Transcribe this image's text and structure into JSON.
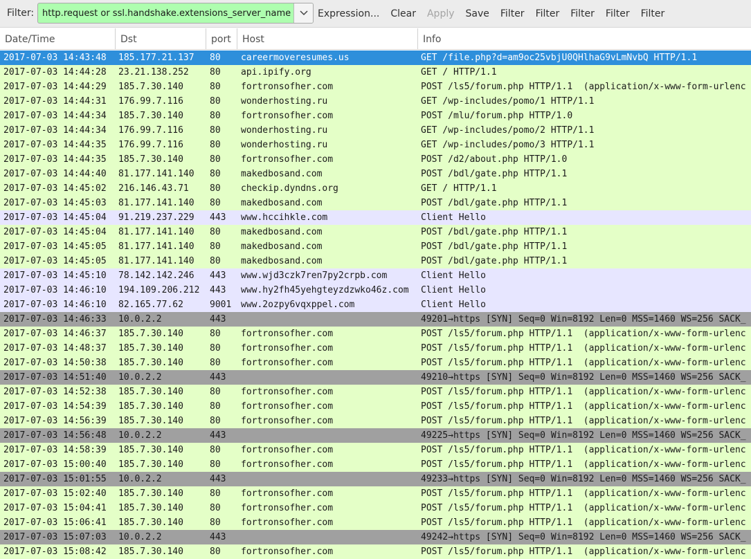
{
  "toolbar": {
    "filter_label": "Filter:",
    "filter_value": "http.request or ssl.handshake.extensions_server_name",
    "buttons": [
      {
        "label": "Expression...",
        "disabled": false
      },
      {
        "label": "Clear",
        "disabled": false
      },
      {
        "label": "Apply",
        "disabled": true
      },
      {
        "label": "Save",
        "disabled": false
      },
      {
        "label": "Filter",
        "disabled": false
      },
      {
        "label": "Filter",
        "disabled": false
      },
      {
        "label": "Filter",
        "disabled": false
      },
      {
        "label": "Filter",
        "disabled": false
      },
      {
        "label": "Filter",
        "disabled": false
      }
    ]
  },
  "columns": [
    "Date/Time",
    "Dst",
    "port",
    "Host",
    "Info"
  ],
  "colors": {
    "selected": "#2e8fdb",
    "http": "#e4ffc7",
    "tls": "#e7e6ff",
    "tcp_syn": "#a0a0a0"
  },
  "rows": [
    {
      "type": "selected",
      "time": "2017-07-03 14:43:48",
      "dst": "185.177.21.137",
      "port": "80",
      "host": "careermoveresumes.us",
      "info": "GET /file.php?d=am9oc25vbjU0QHlhaG9vLmNvbQ HTTP/1.1"
    },
    {
      "type": "http",
      "time": "2017-07-03 14:44:28",
      "dst": "23.21.138.252",
      "port": "80",
      "host": "api.ipify.org",
      "info": "GET / HTTP/1.1"
    },
    {
      "type": "http",
      "time": "2017-07-03 14:44:29",
      "dst": "185.7.30.140",
      "port": "80",
      "host": "fortronsofher.com",
      "info": "POST /ls5/forum.php HTTP/1.1  (application/x-www-form-urlenc"
    },
    {
      "type": "http",
      "time": "2017-07-03 14:44:31",
      "dst": "176.99.7.116",
      "port": "80",
      "host": "wonderhosting.ru",
      "info": "GET /wp-includes/pomo/1 HTTP/1.1"
    },
    {
      "type": "http",
      "time": "2017-07-03 14:44:34",
      "dst": "185.7.30.140",
      "port": "80",
      "host": "fortronsofher.com",
      "info": "POST /mlu/forum.php HTTP/1.0"
    },
    {
      "type": "http",
      "time": "2017-07-03 14:44:34",
      "dst": "176.99.7.116",
      "port": "80",
      "host": "wonderhosting.ru",
      "info": "GET /wp-includes/pomo/2 HTTP/1.1"
    },
    {
      "type": "http",
      "time": "2017-07-03 14:44:35",
      "dst": "176.99.7.116",
      "port": "80",
      "host": "wonderhosting.ru",
      "info": "GET /wp-includes/pomo/3 HTTP/1.1"
    },
    {
      "type": "http",
      "time": "2017-07-03 14:44:35",
      "dst": "185.7.30.140",
      "port": "80",
      "host": "fortronsofher.com",
      "info": "POST /d2/about.php HTTP/1.0"
    },
    {
      "type": "http",
      "time": "2017-07-03 14:44:40",
      "dst": "81.177.141.140",
      "port": "80",
      "host": "makedbosand.com",
      "info": "POST /bdl/gate.php HTTP/1.1"
    },
    {
      "type": "http",
      "time": "2017-07-03 14:45:02",
      "dst": "216.146.43.71",
      "port": "80",
      "host": "checkip.dyndns.org",
      "info": "GET / HTTP/1.1"
    },
    {
      "type": "http",
      "time": "2017-07-03 14:45:03",
      "dst": "81.177.141.140",
      "port": "80",
      "host": "makedbosand.com",
      "info": "POST /bdl/gate.php HTTP/1.1"
    },
    {
      "type": "tls",
      "time": "2017-07-03 14:45:04",
      "dst": "91.219.237.229",
      "port": "443",
      "host": "www.hccihkle.com",
      "info": "Client Hello"
    },
    {
      "type": "http",
      "time": "2017-07-03 14:45:04",
      "dst": "81.177.141.140",
      "port": "80",
      "host": "makedbosand.com",
      "info": "POST /bdl/gate.php HTTP/1.1"
    },
    {
      "type": "http",
      "time": "2017-07-03 14:45:05",
      "dst": "81.177.141.140",
      "port": "80",
      "host": "makedbosand.com",
      "info": "POST /bdl/gate.php HTTP/1.1"
    },
    {
      "type": "http",
      "time": "2017-07-03 14:45:05",
      "dst": "81.177.141.140",
      "port": "80",
      "host": "makedbosand.com",
      "info": "POST /bdl/gate.php HTTP/1.1"
    },
    {
      "type": "tls",
      "time": "2017-07-03 14:45:10",
      "dst": "78.142.142.246",
      "port": "443",
      "host": "www.wjd3czk7ren7py2crpb.com",
      "info": "Client Hello"
    },
    {
      "type": "tls",
      "time": "2017-07-03 14:46:10",
      "dst": "194.109.206.212",
      "port": "443",
      "host": "www.hy2fh45yehgteyzdzwko46z.com",
      "info": "Client Hello"
    },
    {
      "type": "tls",
      "time": "2017-07-03 14:46:10",
      "dst": "82.165.77.62",
      "port": "9001",
      "host": "www.2ozpy6vqxppel.com",
      "info": "Client Hello"
    },
    {
      "type": "tcp_syn",
      "time": "2017-07-03 14:46:33",
      "dst": "10.0.2.2",
      "port": "443",
      "host": "",
      "info": "49201→https [SYN] Seq=0 Win=8192 Len=0 MSS=1460 WS=256 SACK_"
    },
    {
      "type": "http",
      "time": "2017-07-03 14:46:37",
      "dst": "185.7.30.140",
      "port": "80",
      "host": "fortronsofher.com",
      "info": "POST /ls5/forum.php HTTP/1.1  (application/x-www-form-urlenc"
    },
    {
      "type": "http",
      "time": "2017-07-03 14:48:37",
      "dst": "185.7.30.140",
      "port": "80",
      "host": "fortronsofher.com",
      "info": "POST /ls5/forum.php HTTP/1.1  (application/x-www-form-urlenc"
    },
    {
      "type": "http",
      "time": "2017-07-03 14:50:38",
      "dst": "185.7.30.140",
      "port": "80",
      "host": "fortronsofher.com",
      "info": "POST /ls5/forum.php HTTP/1.1  (application/x-www-form-urlenc"
    },
    {
      "type": "tcp_syn",
      "time": "2017-07-03 14:51:40",
      "dst": "10.0.2.2",
      "port": "443",
      "host": "",
      "info": "49210→https [SYN] Seq=0 Win=8192 Len=0 MSS=1460 WS=256 SACK_"
    },
    {
      "type": "http",
      "time": "2017-07-03 14:52:38",
      "dst": "185.7.30.140",
      "port": "80",
      "host": "fortronsofher.com",
      "info": "POST /ls5/forum.php HTTP/1.1  (application/x-www-form-urlenc"
    },
    {
      "type": "http",
      "time": "2017-07-03 14:54:39",
      "dst": "185.7.30.140",
      "port": "80",
      "host": "fortronsofher.com",
      "info": "POST /ls5/forum.php HTTP/1.1  (application/x-www-form-urlenc"
    },
    {
      "type": "http",
      "time": "2017-07-03 14:56:39",
      "dst": "185.7.30.140",
      "port": "80",
      "host": "fortronsofher.com",
      "info": "POST /ls5/forum.php HTTP/1.1  (application/x-www-form-urlenc"
    },
    {
      "type": "tcp_syn",
      "time": "2017-07-03 14:56:48",
      "dst": "10.0.2.2",
      "port": "443",
      "host": "",
      "info": "49225→https [SYN] Seq=0 Win=8192 Len=0 MSS=1460 WS=256 SACK_"
    },
    {
      "type": "http",
      "time": "2017-07-03 14:58:39",
      "dst": "185.7.30.140",
      "port": "80",
      "host": "fortronsofher.com",
      "info": "POST /ls5/forum.php HTTP/1.1  (application/x-www-form-urlenc"
    },
    {
      "type": "http",
      "time": "2017-07-03 15:00:40",
      "dst": "185.7.30.140",
      "port": "80",
      "host": "fortronsofher.com",
      "info": "POST /ls5/forum.php HTTP/1.1  (application/x-www-form-urlenc"
    },
    {
      "type": "tcp_syn",
      "time": "2017-07-03 15:01:55",
      "dst": "10.0.2.2",
      "port": "443",
      "host": "",
      "info": "49233→https [SYN] Seq=0 Win=8192 Len=0 MSS=1460 WS=256 SACK_"
    },
    {
      "type": "http",
      "time": "2017-07-03 15:02:40",
      "dst": "185.7.30.140",
      "port": "80",
      "host": "fortronsofher.com",
      "info": "POST /ls5/forum.php HTTP/1.1  (application/x-www-form-urlenc"
    },
    {
      "type": "http",
      "time": "2017-07-03 15:04:41",
      "dst": "185.7.30.140",
      "port": "80",
      "host": "fortronsofher.com",
      "info": "POST /ls5/forum.php HTTP/1.1  (application/x-www-form-urlenc"
    },
    {
      "type": "http",
      "time": "2017-07-03 15:06:41",
      "dst": "185.7.30.140",
      "port": "80",
      "host": "fortronsofher.com",
      "info": "POST /ls5/forum.php HTTP/1.1  (application/x-www-form-urlenc"
    },
    {
      "type": "tcp_syn",
      "time": "2017-07-03 15:07:03",
      "dst": "10.0.2.2",
      "port": "443",
      "host": "",
      "info": "49242→https [SYN] Seq=0 Win=8192 Len=0 MSS=1460 WS=256 SACK_"
    },
    {
      "type": "http",
      "time": "2017-07-03 15:08:42",
      "dst": "185.7.30.140",
      "port": "80",
      "host": "fortronsofher.com",
      "info": "POST /ls5/forum.php HTTP/1.1  (application/x-www-form-urlenc"
    }
  ]
}
